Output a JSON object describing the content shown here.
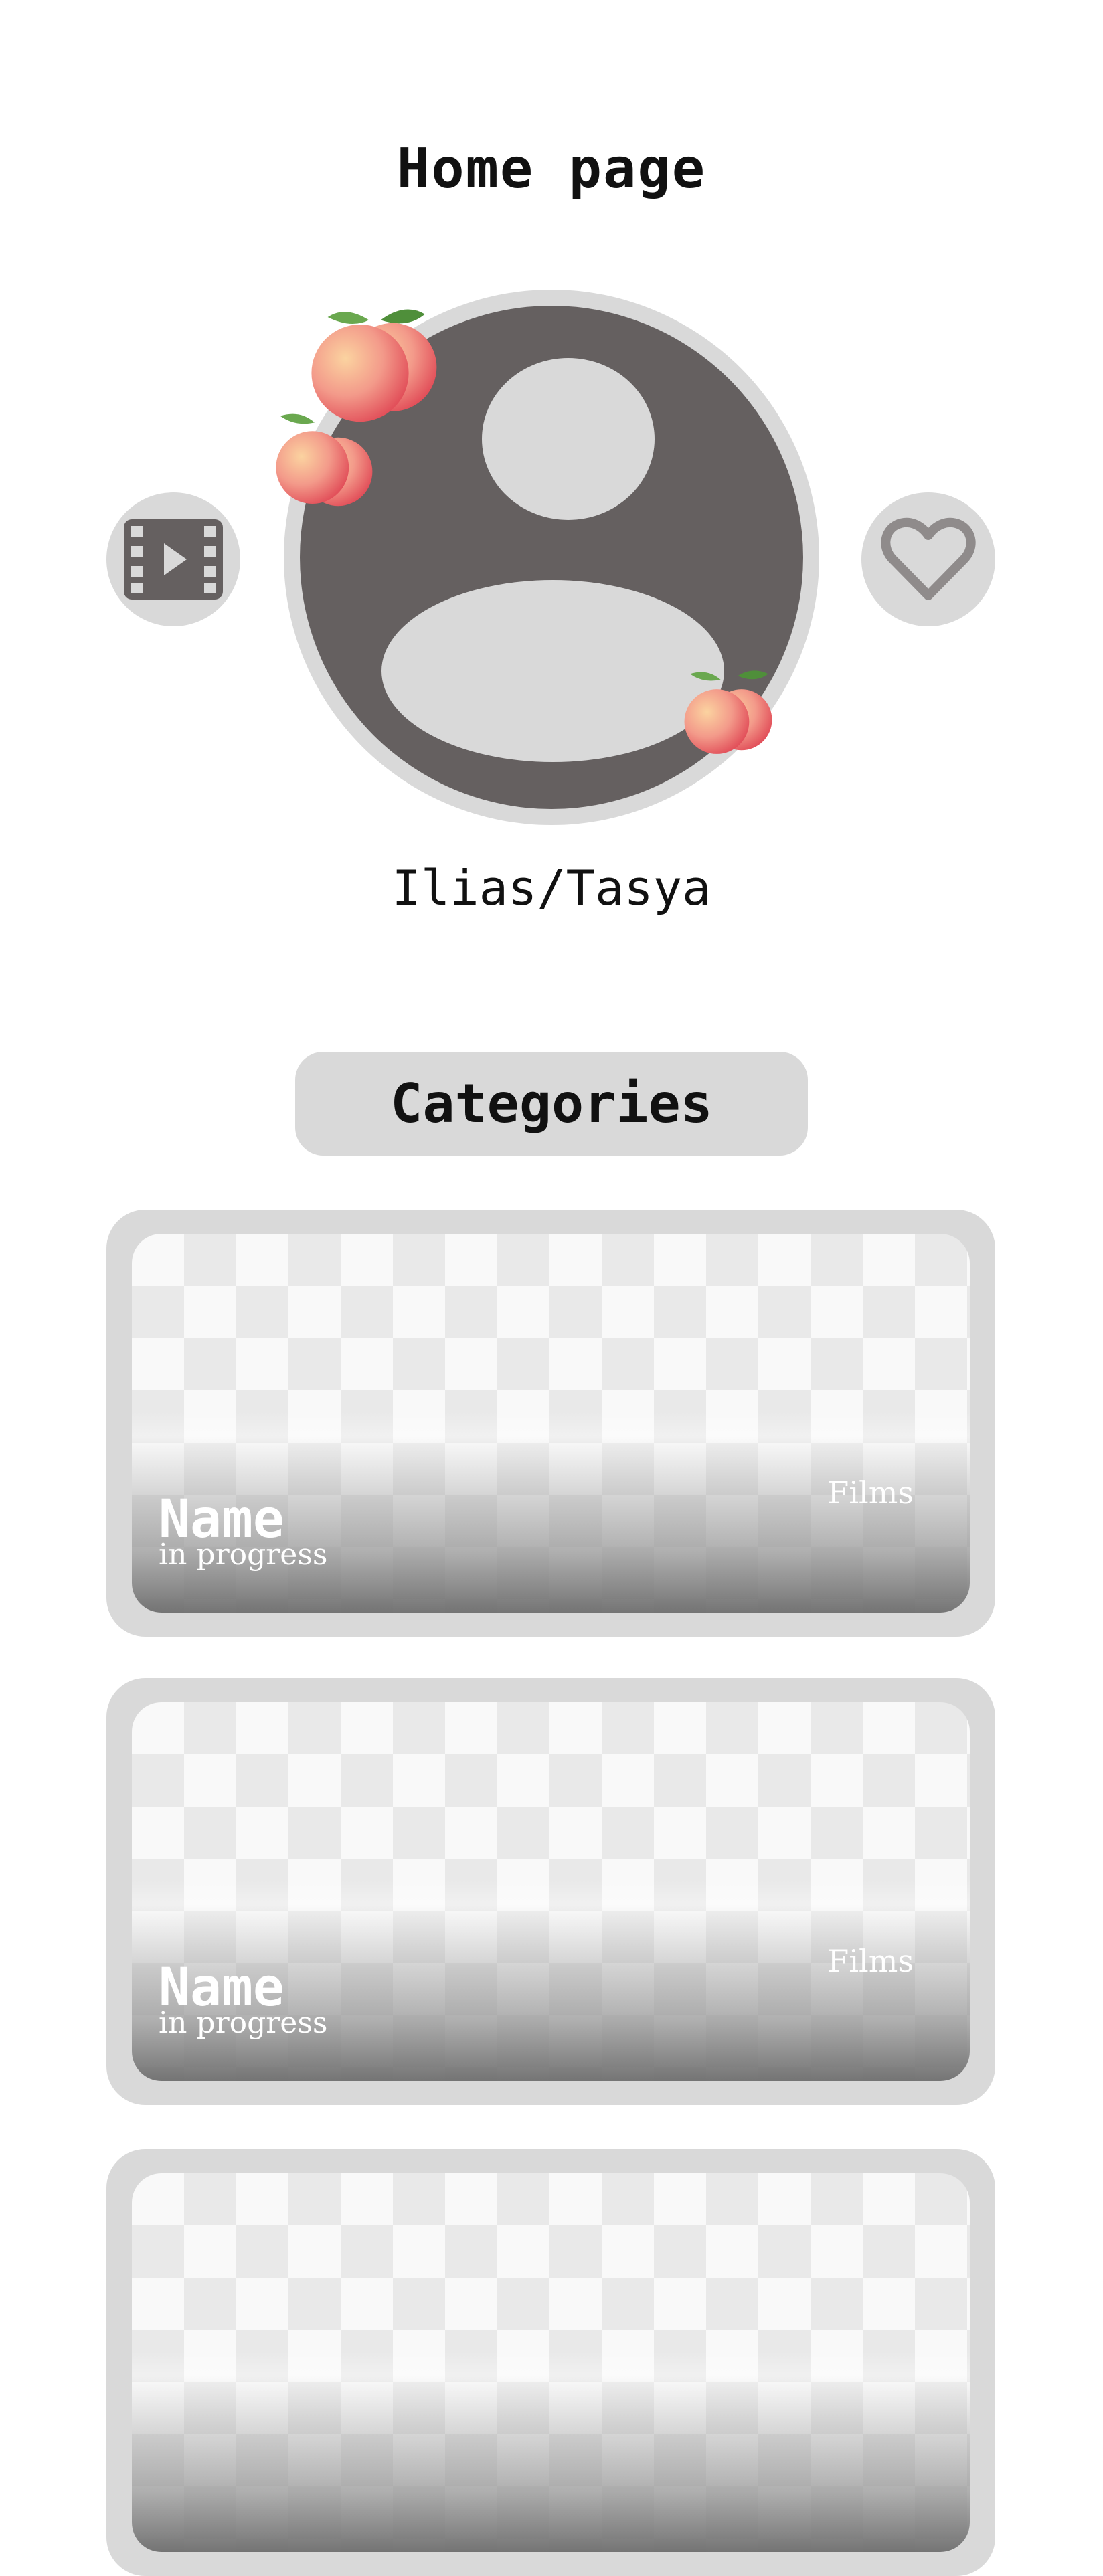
{
  "header": {
    "title": "Home page"
  },
  "profile": {
    "username": "Ilias/Tasya"
  },
  "icons": {
    "left_button": "film-icon",
    "right_button": "heart-icon",
    "decorations": "peach-emoji"
  },
  "categories": {
    "label": "Categories"
  },
  "cards": [
    {
      "name": "Name",
      "subtitle": "in progress",
      "tag": "Films"
    },
    {
      "name": "Name",
      "subtitle": "in progress",
      "tag": "Films"
    },
    {
      "name": "",
      "subtitle": "",
      "tag": ""
    }
  ],
  "colors": {
    "background": "#ffffff",
    "surface": "#d9d9d9",
    "avatar": "#656060",
    "text": "#111111"
  }
}
